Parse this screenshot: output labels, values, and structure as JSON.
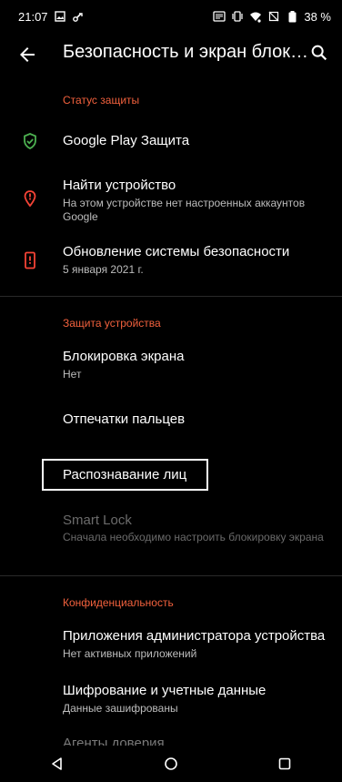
{
  "status_bar": {
    "time": "21:07",
    "battery": "38 %"
  },
  "app_bar": {
    "title": "Безопасность и экран блокиров..."
  },
  "sections": {
    "protection_status": {
      "header": "Статус защиты",
      "items": [
        {
          "title": "Google Play Защита",
          "icon": "shield-check-icon",
          "icon_color": "#4caf50"
        },
        {
          "title": "Найти устройство",
          "subtitle": "На этом устройстве нет настроенных аккаунтов Google",
          "icon": "location-pin-icon",
          "icon_color": "#f44336"
        },
        {
          "title": "Обновление системы безопасности",
          "subtitle": "5 января 2021 г.",
          "icon": "phone-alert-icon",
          "icon_color": "#f44336"
        }
      ]
    },
    "device_protection": {
      "header": "Защита устройства",
      "items": [
        {
          "title": "Блокировка экрана",
          "subtitle": "Нет"
        },
        {
          "title": "Отпечатки пальцев"
        },
        {
          "title": "Распознавание лиц"
        },
        {
          "title": "Smart Lock",
          "subtitle": "Сначала необходимо настроить блокировку экрана",
          "disabled": true
        }
      ]
    },
    "privacy": {
      "header": "Конфиденциальность",
      "items": [
        {
          "title": "Приложения администратора устройства",
          "subtitle": "Нет активных приложений"
        },
        {
          "title": "Шифрование и учетные данные",
          "subtitle": "Данные зашифрованы"
        },
        {
          "title": "Агенты доверия"
        }
      ]
    }
  },
  "colors": {
    "accent": "#f2613d",
    "background": "#000000"
  }
}
